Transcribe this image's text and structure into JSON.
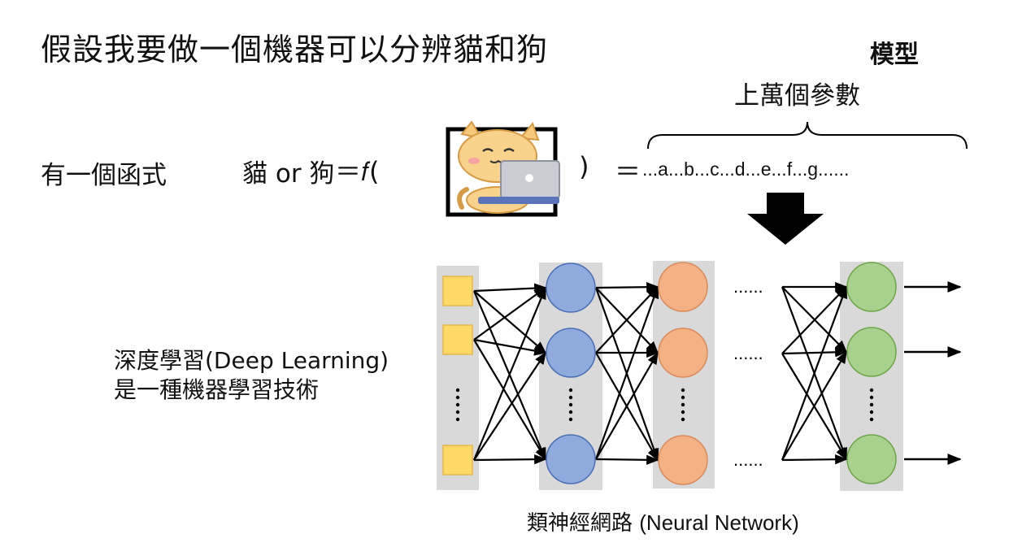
{
  "title": "假設我要做一個機器可以分辨貓和狗",
  "model_label": "模型",
  "params_label": "上萬個參數",
  "function": {
    "label": "有一個函式",
    "cat_or_dog": "貓 or 狗",
    "equals_f": "＝𝑓(",
    "close_paren": ")",
    "equals": "＝",
    "params_expression": "...a...b...c...d...e...f...g......"
  },
  "deep_learning": {
    "line1": "深度學習(Deep Learning)",
    "line2": "是一種機器學習技術"
  },
  "nn_caption": {
    "zh": "類神經網路 ",
    "en": "(Neural Network)"
  },
  "network": {
    "ellipsis_label": "......",
    "colors": {
      "column_bg": "#d9d9d9",
      "input_fill": "#ffd966",
      "input_stroke": "#e6b84a",
      "layer1_fill": "#8faadc",
      "layer1_stroke": "#4a6fb5",
      "layer2_fill": "#f4b183",
      "layer2_stroke": "#d98a5a",
      "output_fill": "#a9d18e",
      "output_stroke": "#6fa54a"
    }
  },
  "icons": {
    "cat": "cat-with-laptop-icon",
    "arrow": "big-down-arrow-icon",
    "brace": "curly-brace-icon"
  }
}
